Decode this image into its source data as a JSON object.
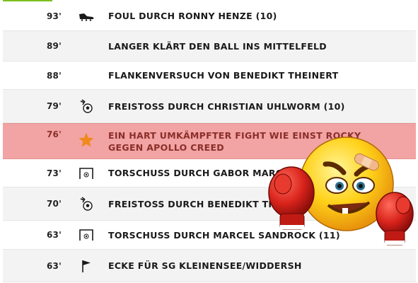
{
  "events": [
    {
      "minute": "93'",
      "icon": "soccer-shoe-icon",
      "text": "FOUL DURCH RONNY HENZE (10)",
      "highlight": false
    },
    {
      "minute": "89'",
      "icon": "",
      "text": "LANGER KLÄRT DEN BALL INS MITTELFELD",
      "highlight": false
    },
    {
      "minute": "88'",
      "icon": "",
      "text": "FLANKENVERSUCH VON BENEDIKT THEINERT",
      "highlight": false
    },
    {
      "minute": "79'",
      "icon": "free-kick-icon",
      "text": "FREISTOSS DURCH CHRISTIAN UHLWORM (10)",
      "highlight": false
    },
    {
      "minute": "76'",
      "icon": "star-icon",
      "text": "EIN HART UMKÄMPFTER FIGHT WIE EINST ROCKY GEGEN APOLLO CREED",
      "highlight": true
    },
    {
      "minute": "73'",
      "icon": "goal-shot-icon",
      "text": "TORSCHUSS DURCH GABOR MARCALI (7)",
      "highlight": false
    },
    {
      "minute": "70'",
      "icon": "free-kick-icon",
      "text": "FREISTOSS DURCH BENEDIKT THEINERT",
      "highlight": false
    },
    {
      "minute": "63'",
      "icon": "goal-shot-icon",
      "text": "TORSCHUSS DURCH MARCEL SANDROCK (11)",
      "highlight": false
    },
    {
      "minute": "63'",
      "icon": "corner-flag-icon",
      "text": "ECKE FÜR SG KLEINENSEE/WIDDERSH",
      "highlight": false
    }
  ],
  "colors": {
    "accent": "#7cbf1d",
    "highlight_bg": "#f2a3a3",
    "highlight_text": "#8a2f2a",
    "star": "#f08a1c"
  },
  "overlay": {
    "icon": "boxing-emoji-icon"
  }
}
